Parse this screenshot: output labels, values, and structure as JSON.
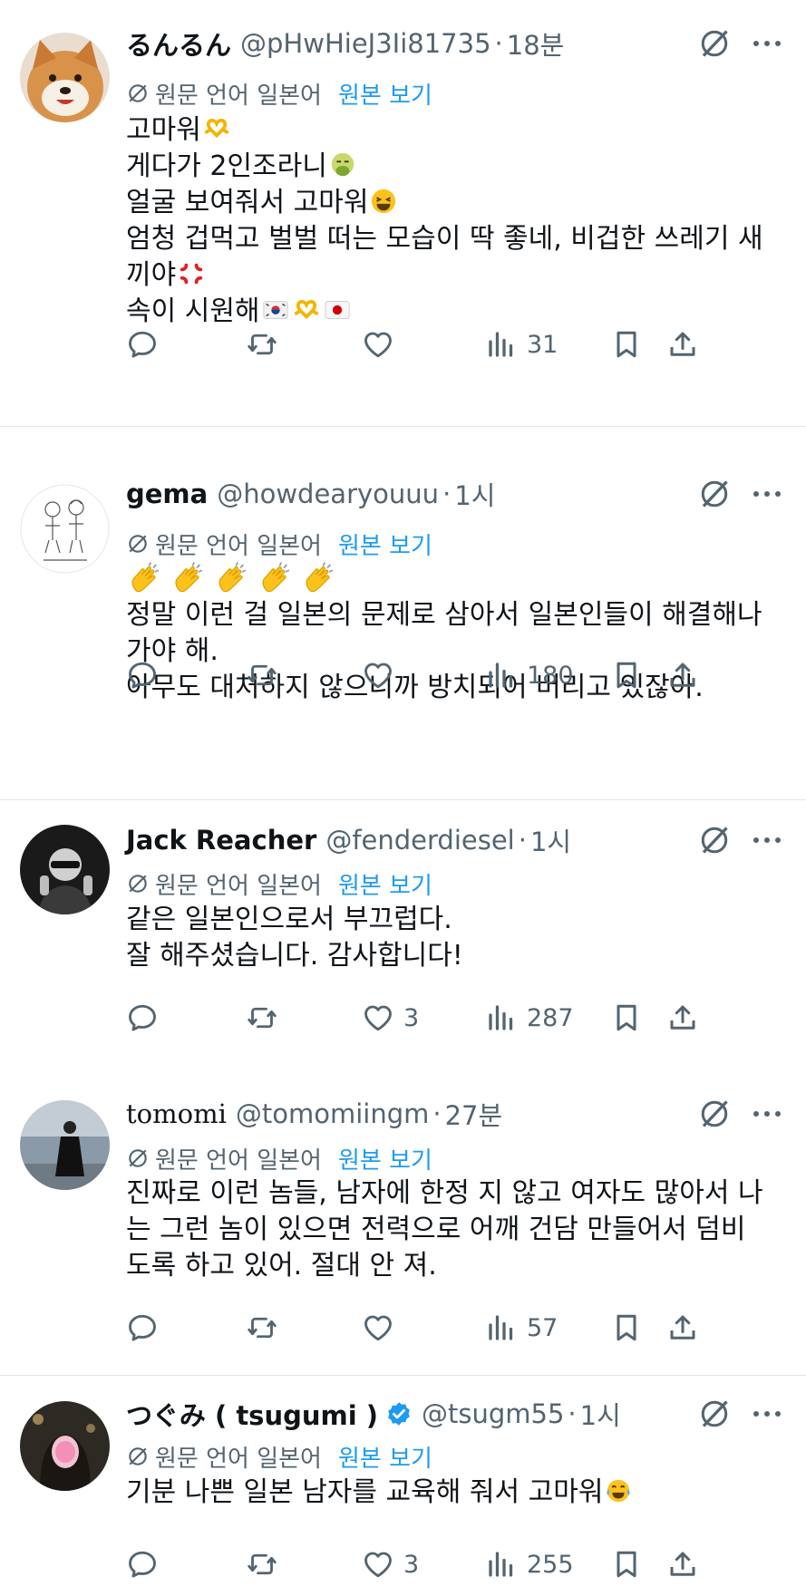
{
  "translate": {
    "label": "원문 언어 일본어",
    "link": "원본 보기"
  },
  "tweets": [
    {
      "display_name": "るんるん",
      "handle": "@pHwHieJ3Ii81735",
      "separator": "·",
      "time": "18분",
      "verified": false,
      "lines": [
        "고마워",
        "게다가 2인조라니",
        "얼굴 보여줘서 고마워",
        "엄청 겁먹고 벌벌 떠는 모습이 딱 좋네, 비겁한 쓰레기 새",
        "끼야",
        "속이 시원해"
      ],
      "counts": {
        "reply": "",
        "repost": "",
        "like": "",
        "views": "31"
      }
    },
    {
      "display_name": "gema",
      "handle": "@howdearyouuu",
      "separator": "·",
      "time": "1시",
      "verified": false,
      "lines": [
        "정말 이런 걸 일본의 문제로 삼아서 일본인들이 해결해나",
        "가야 해.",
        "아무도 대처하지 않으니까 방치되어 버리고 있잖아."
      ],
      "counts": {
        "reply": "",
        "repost": "",
        "like": "",
        "views": "180"
      }
    },
    {
      "display_name": "Jack Reacher",
      "handle": "@fenderdiesel",
      "separator": "·",
      "time": "1시",
      "verified": false,
      "lines": [
        "같은 일본인으로서 부끄럽다.",
        "잘 해주셨습니다. 감사합니다!"
      ],
      "counts": {
        "reply": "",
        "repost": "",
        "like": "3",
        "views": "287"
      }
    },
    {
      "display_name": "tomomi",
      "handle": "@tomomiingm",
      "separator": "·",
      "time": "27분",
      "verified": false,
      "lines": [
        "진짜로 이런 놈들, 남자에 한정 지 않고 여자도 많아서 나",
        "는 그런 놈이 있으면 전력으로 어깨 건담 만들어서 덤비",
        "도록 하고 있어. 절대 안 져."
      ],
      "counts": {
        "reply": "",
        "repost": "",
        "like": "",
        "views": "57"
      }
    },
    {
      "display_name": "つぐみ ( tsugumi )",
      "handle": "@tsugm55",
      "separator": "·",
      "time": "1시",
      "verified": true,
      "lines": [
        "기분 나쁜 일본 남자를 교육해 줘서 고마워"
      ],
      "counts": {
        "reply": "",
        "repost": "",
        "like": "3",
        "views": "255"
      }
    }
  ],
  "icons": [
    "grok-icon",
    "more-icon",
    "translate-icon",
    "reply-icon",
    "repost-icon",
    "like-icon",
    "views-icon",
    "bookmark-icon",
    "share-icon",
    "verified-badge-icon",
    "heart-hands-emoji",
    "nauseated-emoji",
    "grinning-emoji",
    "angry-emoji",
    "korea-flag-emoji",
    "japan-flag-emoji",
    "clapping-emoji",
    "tears-of-joy-emoji"
  ],
  "colors": {
    "text": "#0f1419",
    "secondary": "#536471",
    "link": "#1d9bf0",
    "divider": "#e3e6e8"
  }
}
